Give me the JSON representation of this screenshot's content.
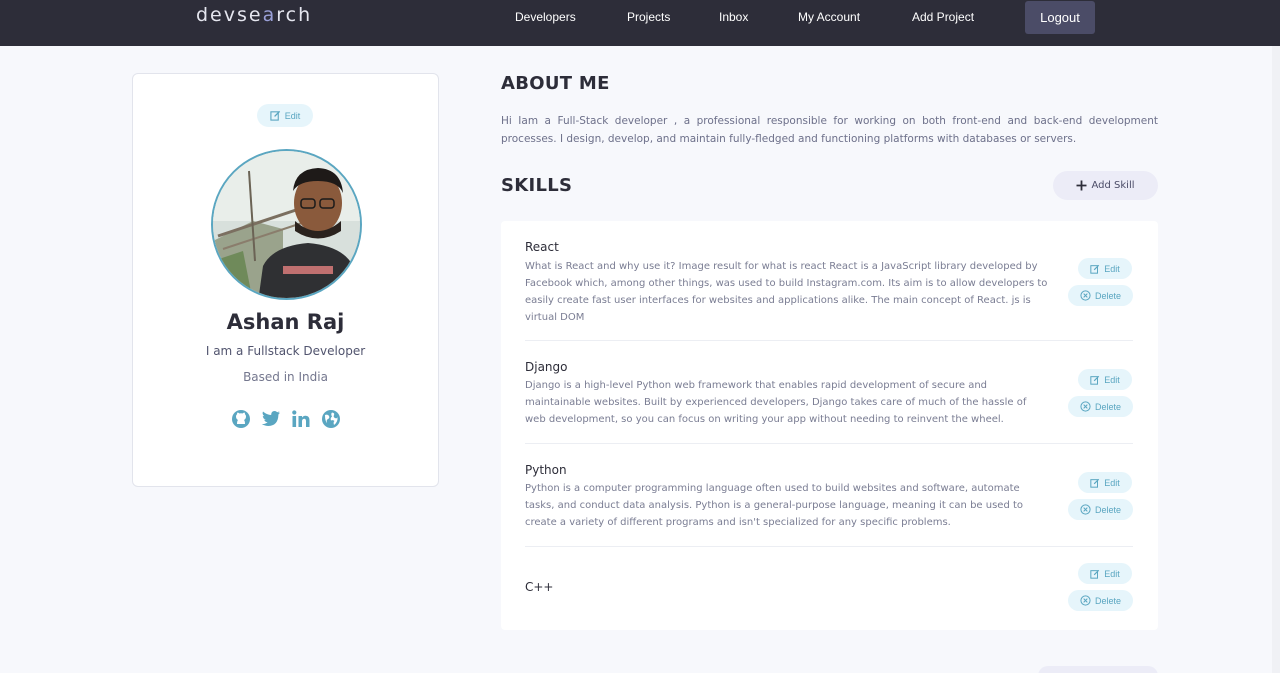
{
  "navbar": {
    "logo_prefix": "devse",
    "logo_mark": "a",
    "logo_suffix": "rch",
    "links": [
      "Developers",
      "Projects",
      "Inbox",
      "My Account",
      "Add Project"
    ],
    "logout_label": "Logout"
  },
  "profile": {
    "edit_label": "Edit",
    "name": "Ashan Raj",
    "title": "I am a Fullstack Developer",
    "location": "Based in India",
    "social_icons": [
      "github-icon",
      "twitter-icon",
      "linkedin-icon",
      "globe-icon"
    ]
  },
  "about": {
    "heading": "ABOUT ME",
    "text": "Hi Iam a Full-Stack developer , a professional responsible for working on both front-end and back-end development processes. I design, develop, and maintain fully-fledged and functioning platforms with databases or servers."
  },
  "skills": {
    "heading": "SKILLS",
    "add_label": "Add Skill",
    "edit_label": "Edit",
    "delete_label": "Delete",
    "items": [
      {
        "name": "React",
        "description": "What is React and why use it? Image result for what is react React is a JavaScript library developed by Facebook which, among other things, was used to build Instagram.com. Its aim is to allow developers to easily create fast user interfaces for websites and applications alike. The main concept of React. js is virtual DOM"
      },
      {
        "name": "Django",
        "description": "Django is a high-level Python web framework that enables rapid development of secure and maintainable websites. Built by experienced developers, Django takes care of much of the hassle of web development, so you can focus on writing your app without needing to reinvent the wheel."
      },
      {
        "name": "Python",
        "description": "Python is a computer programming language often used to build websites and software, automate tasks, and conduct data analysis. Python is a general-purpose language, meaning it can be used to create a variety of different programs and isn't specialized for any specific problems."
      },
      {
        "name": "C++",
        "description": ""
      }
    ]
  },
  "colors": {
    "navbar_bg": "#2d2d39",
    "accent": "#5aa6c1",
    "page_bg": "#f7f8fc"
  }
}
